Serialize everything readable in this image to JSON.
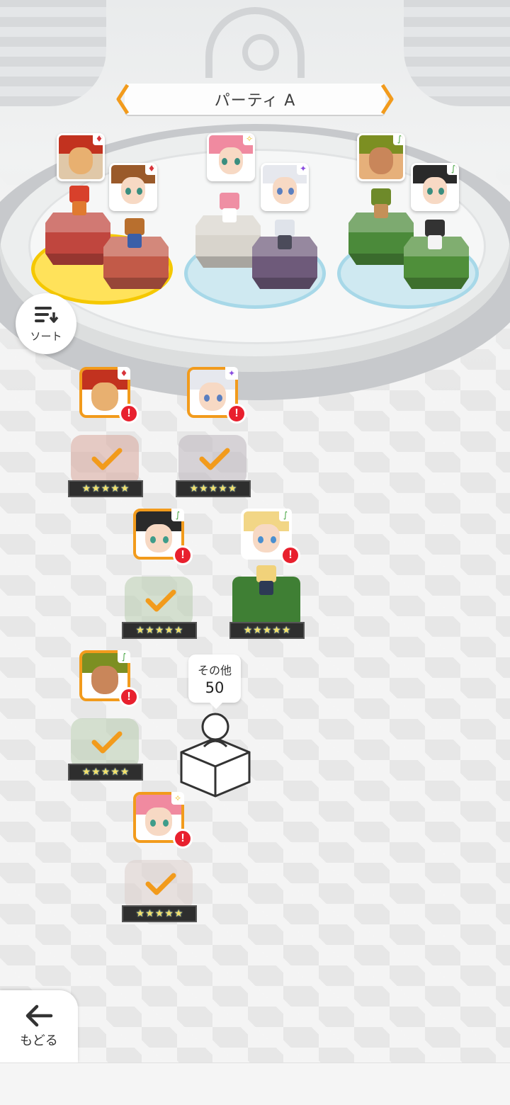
{
  "party": {
    "name": "パーティ A"
  },
  "sort": {
    "label": "ソート"
  },
  "back": {
    "label": "もどる"
  },
  "others": {
    "label": "その他",
    "count": "50"
  },
  "colors": {
    "accent": "#f29b1c",
    "alert": "#e8202e",
    "fire": "#d8343a",
    "wind": "#3fa23a",
    "light": "#ffd34a",
    "dark": "#8a4ee0"
  },
  "formation": [
    {
      "element": "fire",
      "units": [
        "dragon",
        "brown-hair-boy"
      ],
      "active": true
    },
    {
      "element": "light",
      "units": [
        "pink-hair-girl",
        "silver-hair-girl"
      ],
      "active": false
    },
    {
      "element": "wind",
      "units": [
        "green-hair-man",
        "black-hair-girl"
      ],
      "active": false
    }
  ],
  "roster": [
    {
      "id": "dragon",
      "attr_icon": "fire-icon",
      "rarity": 5,
      "selected": true
    },
    {
      "id": "silver-hair-girl",
      "attr_icon": "dark-icon",
      "rarity": 5,
      "selected": true
    },
    {
      "id": "black-hair-girl",
      "attr_icon": "wind-icon",
      "rarity": 5,
      "selected": true
    },
    {
      "id": "blonde-hair-girl",
      "attr_icon": "wind-icon",
      "rarity": 5,
      "selected": false
    },
    {
      "id": "green-hair-man",
      "attr_icon": "wind-icon",
      "rarity": 5,
      "selected": true
    },
    {
      "id": "pink-hair-girl",
      "attr_icon": "light-icon",
      "rarity": 5,
      "selected": true
    }
  ],
  "alert_mark": "!",
  "star_glyph": "★"
}
